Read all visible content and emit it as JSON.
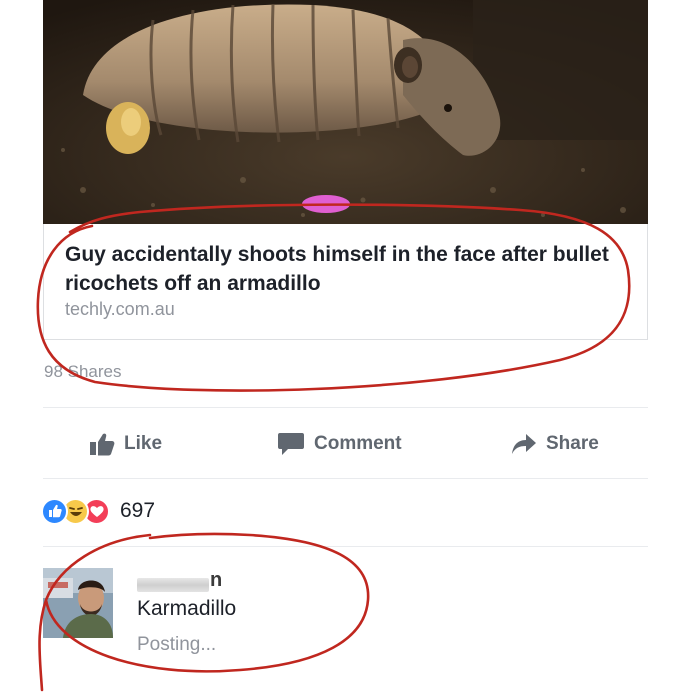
{
  "link_preview": {
    "title": "Guy accidentally shoots himself in the face after bullet ricochets off an armadillo",
    "domain": "techly.com.au",
    "image_subject": "armadillo photo"
  },
  "post_stats": {
    "shares": "98 Shares"
  },
  "actions": {
    "like": "Like",
    "comment": "Comment",
    "share": "Share"
  },
  "reactions": {
    "types": [
      "like",
      "haha",
      "love"
    ],
    "count": "697"
  },
  "comment": {
    "author_visible_suffix": "n",
    "text": "Karmadillo",
    "status": "Posting..."
  },
  "colors": {
    "facebook_blue": "#4267b2",
    "like_blue": "#2d88ff",
    "haha_yellow": "#f7c94b",
    "love_red": "#f33e58",
    "annotation_red": "#c0271f",
    "muted_text": "#90949c",
    "action_text": "#606770"
  },
  "icons": {
    "like": "thumbs-up-icon",
    "comment": "speech-bubble-icon",
    "share": "share-arrow-icon"
  }
}
